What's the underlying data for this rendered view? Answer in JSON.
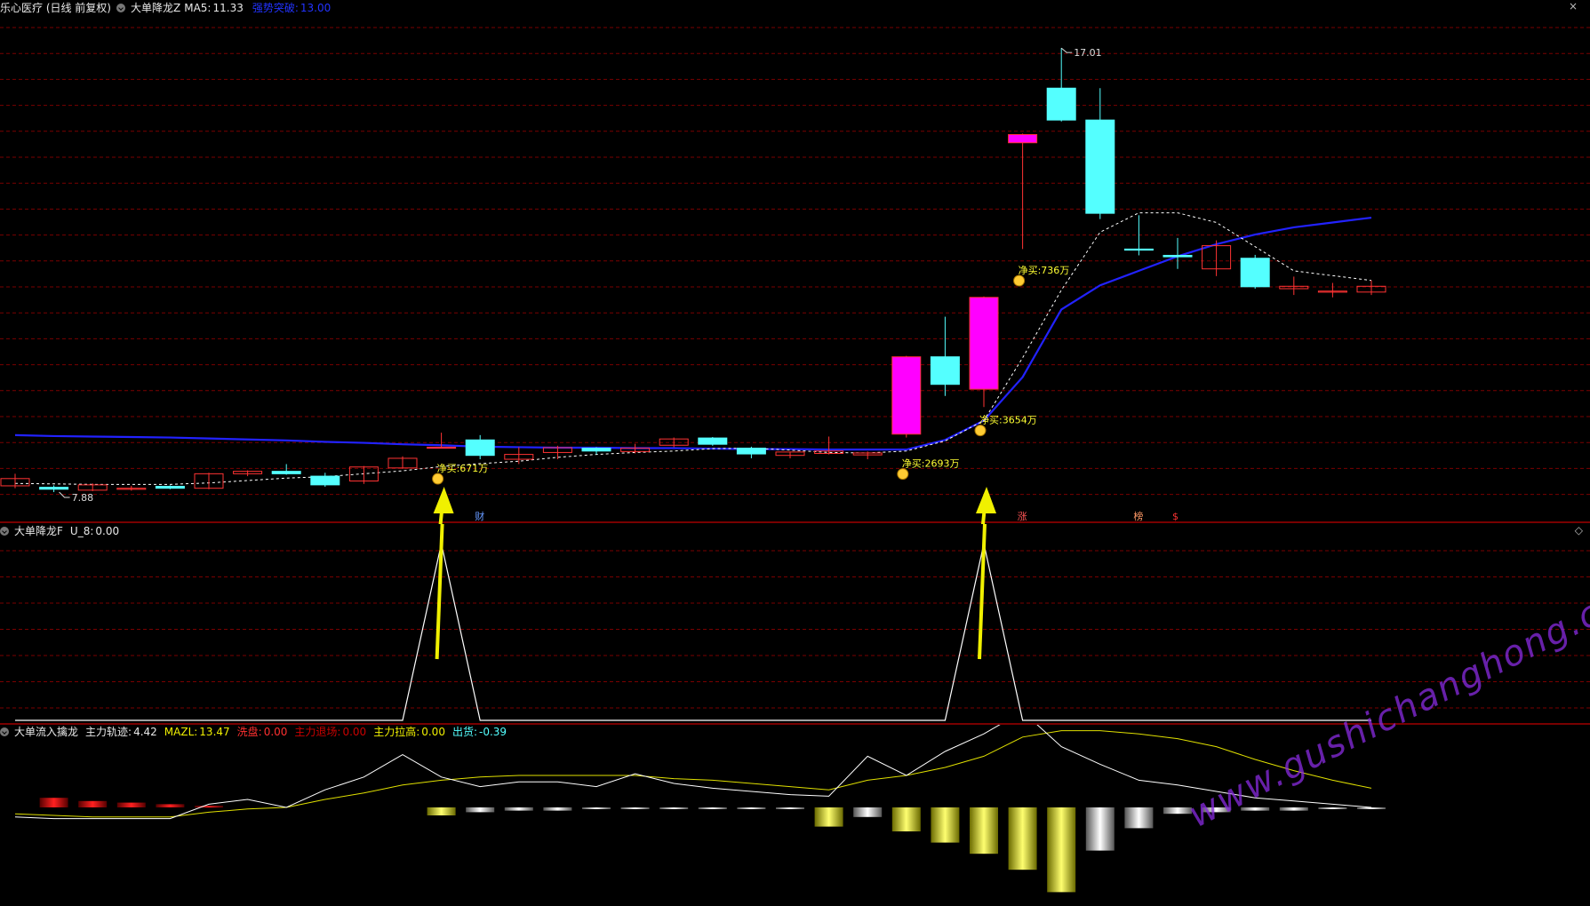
{
  "colors": {
    "up": "#ff3333",
    "down": "#54ffff",
    "fill_up": "#ff00ff",
    "ma": "#2222ff",
    "dashed": "#ffffff",
    "arrow": "#f0f000",
    "grid": "#7a0000",
    "divider": "#a00000"
  },
  "top_panel": {
    "title": "乐心医疗 (日线 前复权)",
    "indicator": "大单降龙Z",
    "ma5_label": "MA5:",
    "ma5_value": "11.33",
    "breakout_label": "强势突破:",
    "breakout_value": "13.00",
    "high_label": "17.01",
    "low_label": "7.88",
    "net_buy": [
      {
        "text": "净买:671万"
      },
      {
        "text": "净买:2693万"
      },
      {
        "text": "净买:3654万"
      },
      {
        "text": "净买:736万"
      }
    ],
    "markers": [
      "财",
      "涨",
      "榜",
      "$"
    ],
    "candles": [
      {
        "o": 7.95,
        "c": 8.1,
        "h": 8.2,
        "l": 7.9
      },
      {
        "o": 7.92,
        "c": 7.88,
        "h": 7.96,
        "l": 7.82
      },
      {
        "o": 7.86,
        "c": 7.97,
        "h": 8.0,
        "l": 7.84
      },
      {
        "o": 7.9,
        "c": 7.9,
        "h": 7.95,
        "l": 7.85
      },
      {
        "o": 7.94,
        "c": 7.9,
        "h": 7.96,
        "l": 7.88
      },
      {
        "o": 7.9,
        "c": 8.2,
        "h": 8.22,
        "l": 7.88
      },
      {
        "o": 8.2,
        "c": 8.25,
        "h": 8.27,
        "l": 8.15
      },
      {
        "o": 8.25,
        "c": 8.2,
        "h": 8.4,
        "l": 8.18
      },
      {
        "o": 8.15,
        "c": 7.97,
        "h": 8.22,
        "l": 7.93
      },
      {
        "o": 8.05,
        "c": 8.34,
        "h": 8.36,
        "l": 7.99
      },
      {
        "o": 8.32,
        "c": 8.52,
        "h": 8.56,
        "l": 8.3
      },
      {
        "o": 8.75,
        "c": 8.75,
        "h": 9.05,
        "l": 8.75,
        "filled": true
      },
      {
        "o": 8.9,
        "c": 8.58,
        "h": 9.0,
        "l": 8.5
      },
      {
        "o": 8.5,
        "c": 8.6,
        "h": 8.75,
        "l": 8.4
      },
      {
        "o": 8.64,
        "c": 8.74,
        "h": 8.78,
        "l": 8.5
      },
      {
        "o": 8.73,
        "c": 8.67,
        "h": 8.75,
        "l": 8.6
      },
      {
        "o": 8.66,
        "c": 8.73,
        "h": 8.82,
        "l": 8.62
      },
      {
        "o": 8.79,
        "c": 8.92,
        "h": 8.95,
        "l": 8.75
      },
      {
        "o": 8.94,
        "c": 8.81,
        "h": 8.96,
        "l": 8.78
      },
      {
        "o": 8.73,
        "c": 8.61,
        "h": 8.76,
        "l": 8.52
      },
      {
        "o": 8.58,
        "c": 8.65,
        "h": 8.66,
        "l": 8.52
      },
      {
        "o": 8.62,
        "c": 8.67,
        "h": 8.97,
        "l": 8.6
      },
      {
        "o": 8.59,
        "c": 8.63,
        "h": 8.66,
        "l": 8.5
      },
      {
        "o": 9.02,
        "c": 10.62,
        "h": 10.64,
        "l": 8.95,
        "filled": true
      },
      {
        "o": 10.62,
        "c": 10.05,
        "h": 11.45,
        "l": 9.81
      },
      {
        "o": 9.95,
        "c": 11.85,
        "h": 11.87,
        "l": 9.58,
        "filled": true
      },
      {
        "o": 15.05,
        "c": 15.22,
        "h": 15.24,
        "l": 12.85,
        "filled": true
      },
      {
        "o": 16.18,
        "c": 15.52,
        "h": 17.01,
        "l": 15.49
      },
      {
        "o": 15.52,
        "c": 13.59,
        "h": 16.18,
        "l": 13.47
      },
      {
        "o": 12.85,
        "c": 12.84,
        "h": 13.55,
        "l": 12.72
      },
      {
        "o": 12.72,
        "c": 12.69,
        "h": 13.08,
        "l": 12.44
      },
      {
        "o": 12.44,
        "c": 12.92,
        "h": 13.03,
        "l": 12.29
      },
      {
        "o": 12.66,
        "c": 12.07,
        "h": 12.73,
        "l": 12.03
      },
      {
        "o": 12.03,
        "c": 12.08,
        "h": 12.28,
        "l": 11.9
      },
      {
        "o": 11.98,
        "c": 11.98,
        "h": 12.15,
        "l": 11.85
      },
      {
        "o": 11.96,
        "c": 12.08,
        "h": 12.2,
        "l": 11.9
      }
    ],
    "ma_blue": [
      9.0,
      8.98,
      8.97,
      8.96,
      8.95,
      8.93,
      8.91,
      8.89,
      8.86,
      8.84,
      8.81,
      8.79,
      8.76,
      8.75,
      8.74,
      8.74,
      8.73,
      8.73,
      8.72,
      8.71,
      8.71,
      8.7,
      8.7,
      8.7,
      8.9,
      9.3,
      10.2,
      11.6,
      12.1,
      12.4,
      12.7,
      12.95,
      13.15,
      13.3,
      13.4,
      13.5
    ],
    "ma_white": [
      8.0,
      7.99,
      7.98,
      7.98,
      7.98,
      8.01,
      8.06,
      8.11,
      8.14,
      8.2,
      8.26,
      8.35,
      8.41,
      8.46,
      8.54,
      8.6,
      8.64,
      8.67,
      8.72,
      8.73,
      8.69,
      8.64,
      8.63,
      8.67,
      8.88,
      9.3,
      10.6,
      12.0,
      13.2,
      13.6,
      13.6,
      13.4,
      12.9,
      12.4,
      12.3,
      12.2
    ]
  },
  "mid_panel": {
    "indicator": "大单降龙F",
    "u8_label": "U_8:",
    "u8_value": "0.00",
    "signal": [
      0,
      0,
      0,
      0,
      0,
      0,
      0,
      0,
      0,
      0,
      0,
      1,
      0,
      0,
      0,
      0,
      0,
      0,
      0,
      0,
      0,
      0,
      0,
      0,
      0,
      1,
      0,
      0,
      0,
      0,
      0,
      0,
      0,
      0,
      0,
      0
    ]
  },
  "bottom_panel": {
    "indicator": "大单流入擒龙",
    "main_track_label": "主力轨迹:",
    "main_track_value": "4.42",
    "mazl_label": "MAZL:",
    "mazl_value": "13.47",
    "wash_label": "洗盘:",
    "wash_value": "0.00",
    "retreat_label": "主力退场:",
    "retreat_value": "0.00",
    "pull_label": "主力拉高:",
    "pull_value": "0.00",
    "ship_label": "出货:",
    "ship_value": "-0.39",
    "bars": [
      {
        "v": 0,
        "t": "none"
      },
      {
        "v": 6,
        "t": "red"
      },
      {
        "v": 4,
        "t": "red"
      },
      {
        "v": 3,
        "t": "red"
      },
      {
        "v": 2,
        "t": "red"
      },
      {
        "v": 1,
        "t": "red"
      },
      {
        "v": 0,
        "t": "none"
      },
      {
        "v": 0,
        "t": "none"
      },
      {
        "v": 0,
        "t": "none"
      },
      {
        "v": 0,
        "t": "none"
      },
      {
        "v": 0,
        "t": "none"
      },
      {
        "v": -5,
        "t": "yellow"
      },
      {
        "v": -3,
        "t": "white"
      },
      {
        "v": -2,
        "t": "white"
      },
      {
        "v": -2,
        "t": "white"
      },
      {
        "v": -1,
        "t": "white"
      },
      {
        "v": -1,
        "t": "white"
      },
      {
        "v": -1,
        "t": "white"
      },
      {
        "v": -1,
        "t": "white"
      },
      {
        "v": -1,
        "t": "white"
      },
      {
        "v": -1,
        "t": "white"
      },
      {
        "v": -12,
        "t": "yellow"
      },
      {
        "v": -6,
        "t": "white"
      },
      {
        "v": -15,
        "t": "yellow"
      },
      {
        "v": -22,
        "t": "yellow"
      },
      {
        "v": -29,
        "t": "yellow"
      },
      {
        "v": -39,
        "t": "yellow"
      },
      {
        "v": -53,
        "t": "yellow"
      },
      {
        "v": -27,
        "t": "white"
      },
      {
        "v": -13,
        "t": "white"
      },
      {
        "v": -4,
        "t": "white"
      },
      {
        "v": -3,
        "t": "white"
      },
      {
        "v": -2,
        "t": "white"
      },
      {
        "v": -2,
        "t": "white"
      },
      {
        "v": -1,
        "t": "white"
      },
      {
        "v": -1,
        "t": "white"
      }
    ],
    "line_white": [
      -6,
      -7,
      -7,
      -7,
      -7,
      2,
      5,
      0,
      11,
      19,
      33,
      19,
      13,
      16,
      16,
      13,
      21,
      15,
      12,
      10,
      8,
      7,
      32,
      20,
      35,
      46,
      60,
      38,
      27,
      17,
      14,
      10,
      6,
      4,
      2,
      0
    ],
    "line_yellow": [
      -4,
      -5,
      -6,
      -6,
      -6,
      -3,
      -1,
      0,
      5,
      9,
      14,
      17,
      19,
      20,
      20,
      20,
      20,
      18,
      17,
      15,
      13,
      11,
      17,
      20,
      25,
      32,
      44,
      48,
      48,
      46,
      43,
      38,
      30,
      23,
      17,
      12
    ]
  },
  "watermark": "www.gushichanghong.com",
  "corner_top": "×",
  "corner_mid": "◇"
}
